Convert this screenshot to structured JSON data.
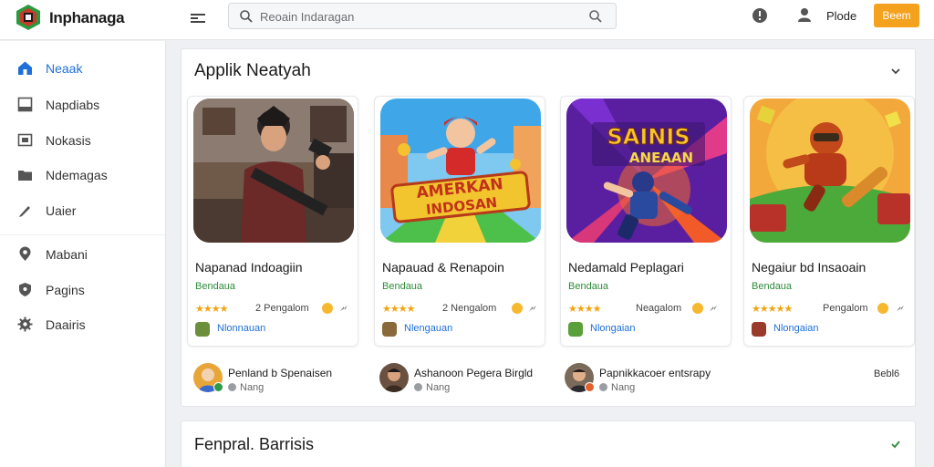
{
  "header": {
    "app_title": "Inphanaga",
    "search_placeholder": "Reoain Indaragan",
    "user_name": "Plode",
    "cta_label": "Beem",
    "icons": [
      "logo-icon",
      "menu-icon",
      "search-icon",
      "help-icon",
      "user-icon"
    ]
  },
  "sidebar": {
    "items": [
      {
        "label": "Neaak",
        "icon": "home-icon",
        "active": true
      },
      {
        "label": "Napdiabs",
        "icon": "apps-icon"
      },
      {
        "label": "Nokasis",
        "icon": "image-icon"
      },
      {
        "label": "Ndemagas",
        "icon": "folder-icon"
      },
      {
        "label": "Uaier",
        "icon": "pencil-icon"
      },
      {
        "label": "Mabani",
        "icon": "location-icon"
      },
      {
        "label": "Pagins",
        "icon": "shield-icon"
      },
      {
        "label": "Daairis",
        "icon": "gear-icon"
      }
    ]
  },
  "section1": {
    "title": "Applik Neatyah",
    "cards": [
      {
        "title": "Napanad Indoagiin",
        "subtitle": "Bendaua",
        "stars": "★★★★",
        "rating_text": "2 Pengalom",
        "developer": "Nlonnauan"
      },
      {
        "title": "Napauad & Renapoin",
        "subtitle": "Bendaua",
        "stars": "★★★★",
        "rating_text": "2 Nengalom",
        "developer": "Nlengauan"
      },
      {
        "title": "Nedamald Peplagari",
        "subtitle": "Bendaua",
        "stars": "★★★★",
        "rating_text": "Neagalom",
        "developer": "Nlongaian"
      },
      {
        "title": "Negaiur bd Insaoain",
        "subtitle": "Bendaua",
        "stars": "★★★★★",
        "rating_text": "Pengalom",
        "developer": "Nlongaian"
      }
    ],
    "art_text": {
      "card2": [
        "AMERKAN",
        "INDOSAN"
      ],
      "card3": [
        "SAINIS",
        "ANEAAN"
      ]
    },
    "reviews": [
      {
        "name": "Penland b Spenaisen",
        "meta": "Nang"
      },
      {
        "name": "Ashanoon Pegera Birgld",
        "meta": "Nang"
      },
      {
        "name": "Papnikkacoer entsrapy",
        "meta": "Nang"
      }
    ],
    "more_label": "Bebl6"
  },
  "section2": {
    "title": "Fenpral. Barrisis"
  },
  "colors": {
    "accent": "#1e6fd9",
    "cta": "#f4a21e",
    "star": "#f2a40f",
    "subtitle_green": "#2e8b3a"
  }
}
